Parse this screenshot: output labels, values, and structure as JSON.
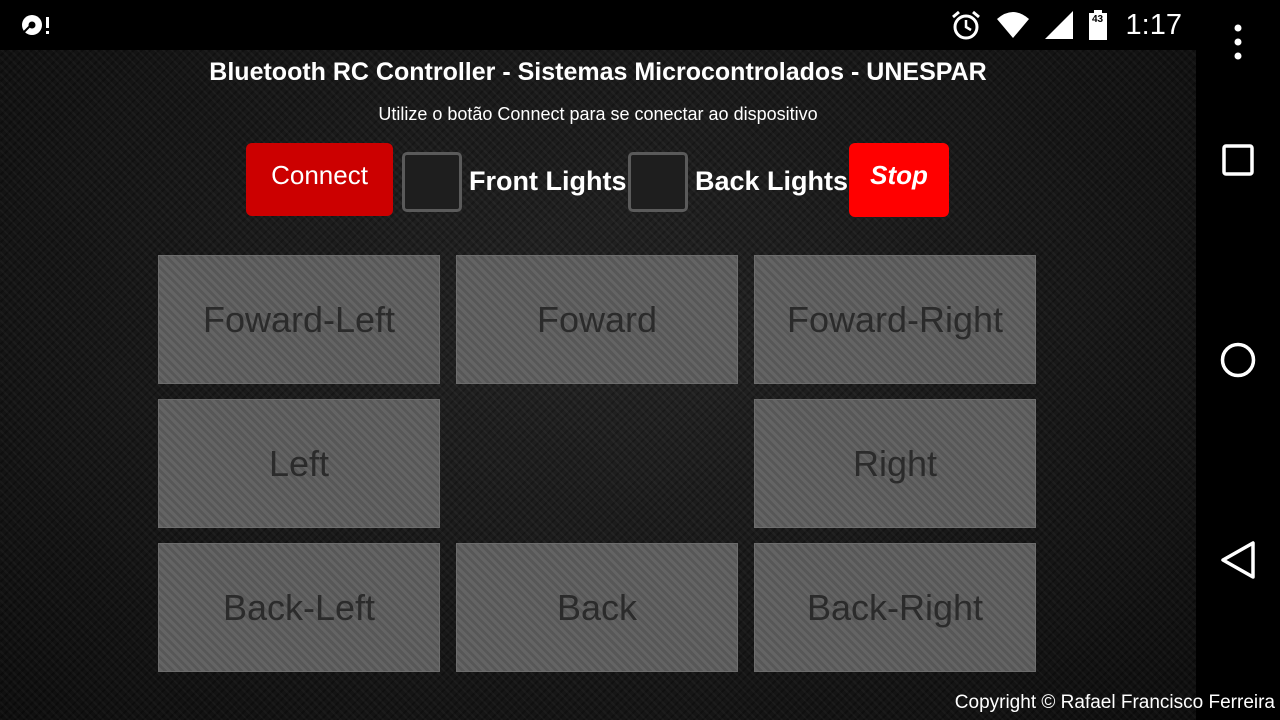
{
  "status_bar": {
    "left_icon": "debug-notification-icon",
    "alarm_icon": "alarm-clock-icon",
    "wifi_icon": "wifi-signal-icon",
    "cell_icon": "cell-signal-icon",
    "battery_icon": "battery-icon",
    "battery_level": "43",
    "time": "1:17"
  },
  "app": {
    "title": "Bluetooth RC Controller - Sistemas Microcontrolados - UNESPAR",
    "subtitle": "Utilize o botão Connect para se conectar ao dispositivo",
    "connect_label": "Connect",
    "front_lights_label": "Front Lights",
    "front_lights_checked": false,
    "back_lights_label": "Back Lights",
    "back_lights_checked": false,
    "stop_label": "Stop",
    "copyright": "Copyright © Rafael Francisco Ferreira"
  },
  "controls": {
    "forward_left": "Foward-Left",
    "forward": "Foward",
    "forward_right": "Foward-Right",
    "left": "Left",
    "right": "Right",
    "back_left": "Back-Left",
    "back": "Back",
    "back_right": "Back-Right"
  },
  "nav_bar": {
    "menu_icon": "overflow-menu-icon",
    "recents_icon": "recents-square-icon",
    "home_icon": "home-circle-icon",
    "back_icon": "back-triangle-icon"
  },
  "colors": {
    "connect_button": "#cc0000",
    "stop_button": "#ff0000",
    "direction_button": "#5c5c5c",
    "direction_text": "#2b2b2b"
  }
}
